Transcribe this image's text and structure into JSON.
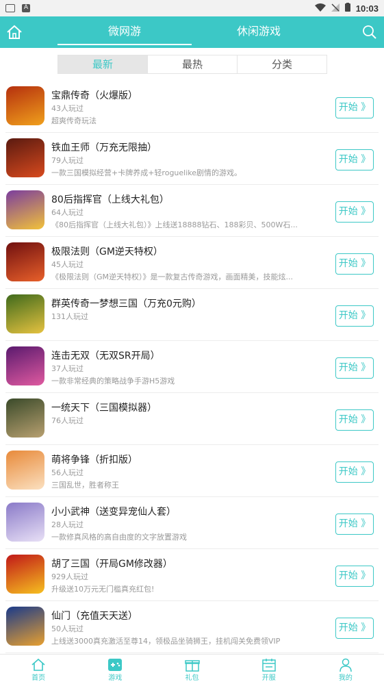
{
  "status_bar": {
    "time": "10:03",
    "battery": "B"
  },
  "top_tabs": [
    {
      "label": "微网游",
      "active": true
    },
    {
      "label": "休闲游戏",
      "active": false
    }
  ],
  "segments": [
    {
      "label": "最新",
      "active": true
    },
    {
      "label": "最热",
      "active": false
    },
    {
      "label": "分类",
      "active": false
    }
  ],
  "start_label": "开始 》",
  "games": [
    {
      "name": "宝鼎传奇（火爆版）",
      "players": "43人玩过",
      "desc": "超爽传奇玩法",
      "colors": [
        "#b5300e",
        "#f0a01c"
      ]
    },
    {
      "name": "铁血王师（万充无限抽）",
      "players": "79人玩过",
      "desc": "一款三国模拟经营+卡牌养成+轻roguelike剧情的游戏。",
      "colors": [
        "#5a1a10",
        "#d84a1e"
      ]
    },
    {
      "name": "80后指挥官（上线大礼包）",
      "players": "64人玩过",
      "desc": "《80后指挥官（上线大礼包）》上线送18888钻石、188彩贝、500W石...",
      "colors": [
        "#7b3d9e",
        "#f2c23a"
      ]
    },
    {
      "name": "极限法则（GM逆天特权）",
      "players": "45人玩过",
      "desc": "《极限法则（GM逆天特权）》是一款复古传奇游戏，画面精美，技能炫...",
      "colors": [
        "#701010",
        "#e8602a"
      ]
    },
    {
      "name": "群英传奇一梦想三国（万充0元购）",
      "players": "131人玩过",
      "desc": "",
      "colors": [
        "#3f6a1c",
        "#e6c240"
      ]
    },
    {
      "name": "连击无双（无双SR开局）",
      "players": "37人玩过",
      "desc": "一款非常经典的策略战争手游H5游戏",
      "colors": [
        "#5a1a6e",
        "#e05aa0"
      ]
    },
    {
      "name": "一统天下（三国模拟器）",
      "players": "76人玩过",
      "desc": "",
      "colors": [
        "#3a4a2a",
        "#b8a070"
      ]
    },
    {
      "name": "萌将争锋（折扣版）",
      "players": "56人玩过",
      "desc": "三国乱世，胜者称王",
      "colors": [
        "#e88a3a",
        "#fbe0c0"
      ]
    },
    {
      "name": "小小武神（送变异宠仙人套）",
      "players": "28人玩过",
      "desc": "一款修真风格的高自由度的文字放置游戏",
      "colors": [
        "#8a7ac8",
        "#e8e0f6"
      ]
    },
    {
      "name": "胡了三国（开局GM修改器）",
      "players": "929人玩过",
      "desc": "升级送10万元无门槛真充红包!",
      "colors": [
        "#c01818",
        "#f6c020"
      ]
    },
    {
      "name": "仙门（充值天天送）",
      "players": "50人玩过",
      "desc": "上线送3000真充激活至尊14，领极品坐骑狮王，挂机闯关免费领VIP",
      "colors": [
        "#1a3a8a",
        "#e8a030"
      ]
    }
  ],
  "bottom_nav": [
    {
      "label": "首页",
      "icon": "home-icon"
    },
    {
      "label": "游戏",
      "icon": "gamepad-icon"
    },
    {
      "label": "礼包",
      "icon": "gift-icon"
    },
    {
      "label": "开服",
      "icon": "calendar-icon"
    },
    {
      "label": "我的",
      "icon": "user-icon"
    }
  ],
  "theme": {
    "accent": "#3cc8c6"
  }
}
